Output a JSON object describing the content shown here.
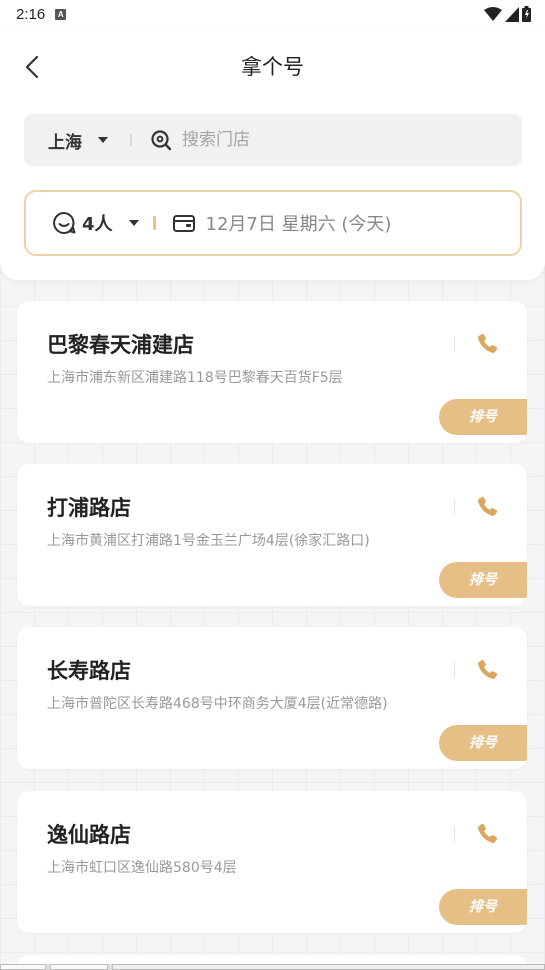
{
  "status_bar": {
    "time": "2:16",
    "notif_glyph": "A"
  },
  "header": {
    "title": "拿个号"
  },
  "search": {
    "city": "上海",
    "placeholder": "搜索门店"
  },
  "filter": {
    "people": "4人",
    "date": "12月7日 星期六 (今天)"
  },
  "stores": [
    {
      "name": "巴黎春天浦建店",
      "address": "上海市浦东新区浦建路118号巴黎春天百货F5层",
      "queue_label": "排号"
    },
    {
      "name": "打浦路店",
      "address": "上海市黄浦区打浦路1号金玉兰广场4层(徐家汇路口)",
      "queue_label": "排号"
    },
    {
      "name": "长寿路店",
      "address": "上海市普陀区长寿路468号中环商务大厦4层(近常德路)",
      "queue_label": "排号"
    },
    {
      "name": "逸仙路店",
      "address": "上海市虹口区逸仙路580号4层",
      "queue_label": "排号"
    }
  ],
  "colors": {
    "accent": "#e6bf86",
    "accent_border": "#ebd3a9"
  },
  "icons": [
    "back-arrow",
    "search-icon",
    "chat-icon",
    "calendar-icon",
    "phone-icon",
    "wifi-icon",
    "signal-icon",
    "battery-icon"
  ]
}
